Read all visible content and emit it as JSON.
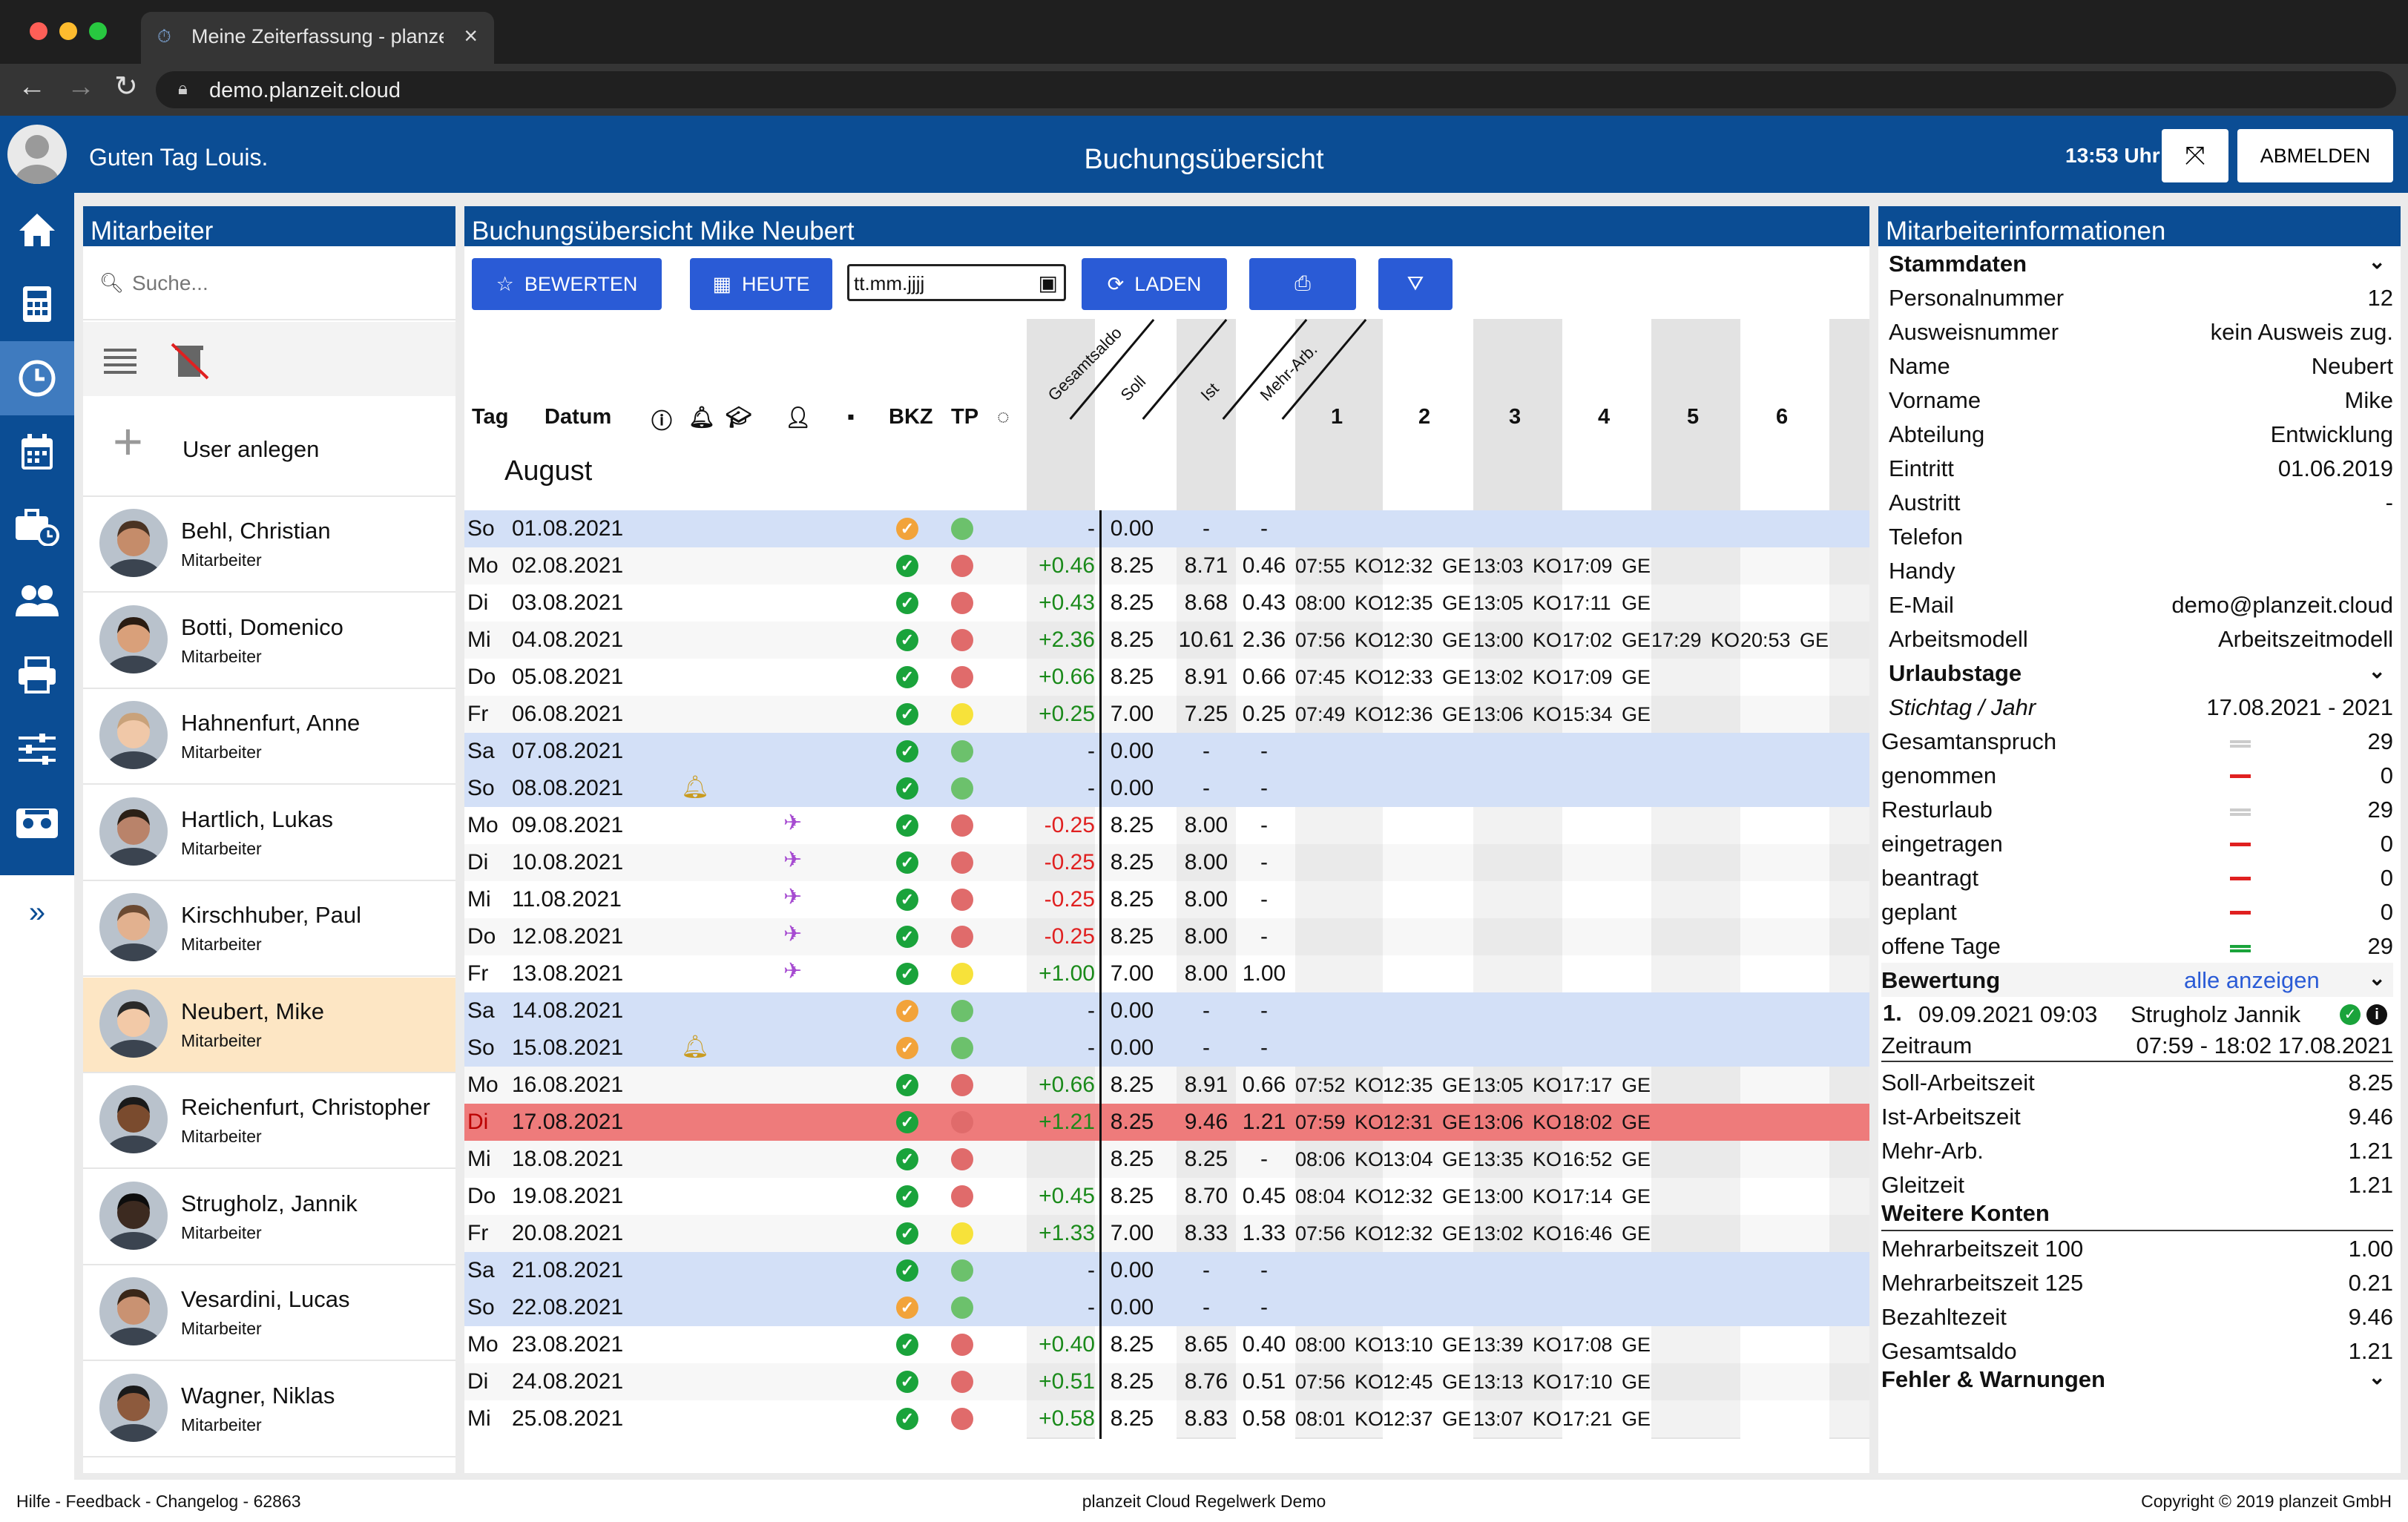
{
  "browser": {
    "tab_title": "Meine Zeiterfassung - planzeit",
    "url": "demo.planzeit.cloud"
  },
  "header": {
    "greeting": "Guten Tag Louis.",
    "title": "Buchungsübersicht",
    "clock": "13:53 Uhr",
    "logout": "ABMELDEN"
  },
  "nav": {
    "items": [
      "home-icon",
      "calculator-icon",
      "clock-icon",
      "calendar-icon",
      "briefcase-clock-icon",
      "users-icon",
      "printer-icon",
      "sliders-icon",
      "cassette-icon",
      "expand-icon"
    ]
  },
  "staff": {
    "title": "Mitarbeiter",
    "search_placeholder": "Suche...",
    "add_user": "User anlegen",
    "people": [
      {
        "name": "Behl, Christian",
        "role": "Mitarbeiter"
      },
      {
        "name": "Botti, Domenico",
        "role": "Mitarbeiter"
      },
      {
        "name": "Hahnenfurt, Anne",
        "role": "Mitarbeiter"
      },
      {
        "name": "Hartlich, Lukas",
        "role": "Mitarbeiter"
      },
      {
        "name": "Kirschhuber, Paul",
        "role": "Mitarbeiter"
      },
      {
        "name": "Neubert, Mike",
        "role": "Mitarbeiter"
      },
      {
        "name": "Reichenfurt, Christopher",
        "role": "Mitarbeiter"
      },
      {
        "name": "Strugholz, Jannik",
        "role": "Mitarbeiter"
      },
      {
        "name": "Vesardini, Lucas",
        "role": "Mitarbeiter"
      },
      {
        "name": "Wagner, Niklas",
        "role": "Mitarbeiter"
      }
    ],
    "selected": 5
  },
  "booking": {
    "title": "Buchungsübersicht  Mike Neubert",
    "buttons": {
      "rate": "BEWERTEN",
      "today": "HEUTE",
      "load": "LADEN"
    },
    "date_placeholder": "tt.mm.jjjj",
    "headers": {
      "day": "Tag",
      "date": "Datum",
      "bkz": "BKZ",
      "tp": "TP",
      "total": "Gesamtsaldo",
      "soll": "Soll",
      "ist": "Ist",
      "mehr": "Mehr-Arb.",
      "cols": [
        "1",
        "2",
        "3",
        "4",
        "5",
        "6"
      ]
    },
    "month": "August",
    "rows": [
      {
        "d": "So",
        "dt": "01.08.2021",
        "ic": "",
        "bk": "o",
        "tp": "g",
        "tot": "-",
        "soll": "0.00",
        "ist": "-",
        "mehr": "-",
        "t": [],
        "we": 1
      },
      {
        "d": "Mo",
        "dt": "02.08.2021",
        "ic": "",
        "bk": "g",
        "tp": "r",
        "tot": "+0.46",
        "soll": "8.25",
        "ist": "8.71",
        "mehr": "0.46",
        "t": [
          "07:55",
          "KO",
          "12:32",
          "GE",
          "13:03",
          "KO",
          "17:09",
          "GE"
        ]
      },
      {
        "d": "Di",
        "dt": "03.08.2021",
        "ic": "",
        "bk": "g",
        "tp": "r",
        "tot": "+0.43",
        "soll": "8.25",
        "ist": "8.68",
        "mehr": "0.43",
        "t": [
          "08:00",
          "KO",
          "12:35",
          "GE",
          "13:05",
          "KO",
          "17:11",
          "GE"
        ]
      },
      {
        "d": "Mi",
        "dt": "04.08.2021",
        "ic": "",
        "bk": "g",
        "tp": "r",
        "tot": "+2.36",
        "soll": "8.25",
        "ist": "10.61",
        "mehr": "2.36",
        "t": [
          "07:56",
          "KO",
          "12:30",
          "GE",
          "13:00",
          "KO",
          "17:02",
          "GE",
          "17:29",
          "KO",
          "20:53",
          "GE"
        ]
      },
      {
        "d": "Do",
        "dt": "05.08.2021",
        "ic": "",
        "bk": "g",
        "tp": "r",
        "tot": "+0.66",
        "soll": "8.25",
        "ist": "8.91",
        "mehr": "0.66",
        "t": [
          "07:45",
          "KO",
          "12:33",
          "GE",
          "13:02",
          "KO",
          "17:09",
          "GE"
        ]
      },
      {
        "d": "Fr",
        "dt": "06.08.2021",
        "ic": "",
        "bk": "g",
        "tp": "y",
        "tot": "+0.25",
        "soll": "7.00",
        "ist": "7.25",
        "mehr": "0.25",
        "t": [
          "07:49",
          "KO",
          "12:36",
          "GE",
          "13:06",
          "KO",
          "15:34",
          "GE"
        ]
      },
      {
        "d": "Sa",
        "dt": "07.08.2021",
        "ic": "",
        "bk": "g",
        "tp": "g",
        "tot": "-",
        "soll": "0.00",
        "ist": "-",
        "mehr": "-",
        "t": [],
        "we": 1
      },
      {
        "d": "So",
        "dt": "08.08.2021",
        "ic": "bell",
        "bk": "g",
        "tp": "g",
        "tot": "-",
        "soll": "0.00",
        "ist": "-",
        "mehr": "-",
        "t": [],
        "we": 1
      },
      {
        "d": "Mo",
        "dt": "09.08.2021",
        "ic": "plane",
        "bk": "g",
        "tp": "r",
        "tot": "-0.25",
        "soll": "8.25",
        "ist": "8.00",
        "mehr": "-",
        "t": []
      },
      {
        "d": "Di",
        "dt": "10.08.2021",
        "ic": "plane",
        "bk": "g",
        "tp": "r",
        "tot": "-0.25",
        "soll": "8.25",
        "ist": "8.00",
        "mehr": "-",
        "t": []
      },
      {
        "d": "Mi",
        "dt": "11.08.2021",
        "ic": "plane",
        "bk": "g",
        "tp": "r",
        "tot": "-0.25",
        "soll": "8.25",
        "ist": "8.00",
        "mehr": "-",
        "t": []
      },
      {
        "d": "Do",
        "dt": "12.08.2021",
        "ic": "plane",
        "bk": "g",
        "tp": "r",
        "tot": "-0.25",
        "soll": "8.25",
        "ist": "8.00",
        "mehr": "-",
        "t": []
      },
      {
        "d": "Fr",
        "dt": "13.08.2021",
        "ic": "plane",
        "bk": "g",
        "tp": "y",
        "tot": "+1.00",
        "soll": "7.00",
        "ist": "8.00",
        "mehr": "1.00",
        "t": []
      },
      {
        "d": "Sa",
        "dt": "14.08.2021",
        "ic": "",
        "bk": "o",
        "tp": "g",
        "tot": "-",
        "soll": "0.00",
        "ist": "-",
        "mehr": "-",
        "t": [],
        "we": 1
      },
      {
        "d": "So",
        "dt": "15.08.2021",
        "ic": "bell",
        "bk": "o",
        "tp": "g",
        "tot": "-",
        "soll": "0.00",
        "ist": "-",
        "mehr": "-",
        "t": [],
        "we": 1
      },
      {
        "d": "Mo",
        "dt": "16.08.2021",
        "ic": "",
        "bk": "g",
        "tp": "r",
        "tot": "+0.66",
        "soll": "8.25",
        "ist": "8.91",
        "mehr": "0.66",
        "t": [
          "07:52",
          "KO",
          "12:35",
          "GE",
          "13:05",
          "KO",
          "17:17",
          "GE"
        ]
      },
      {
        "d": "Di",
        "dt": "17.08.2021",
        "ic": "",
        "bk": "g",
        "tp": "r",
        "tot": "+1.21",
        "soll": "8.25",
        "ist": "9.46",
        "mehr": "1.21",
        "t": [
          "07:59",
          "KO",
          "12:31",
          "GE",
          "13:06",
          "KO",
          "18:02",
          "GE"
        ],
        "hl": 1
      },
      {
        "d": "Mi",
        "dt": "18.08.2021",
        "ic": "",
        "bk": "g",
        "tp": "r",
        "tot": "",
        "soll": "8.25",
        "ist": "8.25",
        "mehr": "-",
        "t": [
          "08:06",
          "KO",
          "13:04",
          "GE",
          "13:35",
          "KO",
          "16:52",
          "GE"
        ]
      },
      {
        "d": "Do",
        "dt": "19.08.2021",
        "ic": "",
        "bk": "g",
        "tp": "r",
        "tot": "+0.45",
        "soll": "8.25",
        "ist": "8.70",
        "mehr": "0.45",
        "t": [
          "08:04",
          "KO",
          "12:32",
          "GE",
          "13:00",
          "KO",
          "17:14",
          "GE"
        ]
      },
      {
        "d": "Fr",
        "dt": "20.08.2021",
        "ic": "",
        "bk": "g",
        "tp": "y",
        "tot": "+1.33",
        "soll": "7.00",
        "ist": "8.33",
        "mehr": "1.33",
        "t": [
          "07:56",
          "KO",
          "12:32",
          "GE",
          "13:02",
          "KO",
          "16:46",
          "GE"
        ]
      },
      {
        "d": "Sa",
        "dt": "21.08.2021",
        "ic": "",
        "bk": "g",
        "tp": "g",
        "tot": "-",
        "soll": "0.00",
        "ist": "-",
        "mehr": "-",
        "t": [],
        "we": 1
      },
      {
        "d": "So",
        "dt": "22.08.2021",
        "ic": "",
        "bk": "o",
        "tp": "g",
        "tot": "-",
        "soll": "0.00",
        "ist": "-",
        "mehr": "-",
        "t": [],
        "we": 1
      },
      {
        "d": "Mo",
        "dt": "23.08.2021",
        "ic": "",
        "bk": "g",
        "tp": "r",
        "tot": "+0.40",
        "soll": "8.25",
        "ist": "8.65",
        "mehr": "0.40",
        "t": [
          "08:00",
          "KO",
          "13:10",
          "GE",
          "13:39",
          "KO",
          "17:08",
          "GE"
        ]
      },
      {
        "d": "Di",
        "dt": "24.08.2021",
        "ic": "",
        "bk": "g",
        "tp": "r",
        "tot": "+0.51",
        "soll": "8.25",
        "ist": "8.76",
        "mehr": "0.51",
        "t": [
          "07:56",
          "KO",
          "12:45",
          "GE",
          "13:13",
          "KO",
          "17:10",
          "GE"
        ]
      },
      {
        "d": "Mi",
        "dt": "25.08.2021",
        "ic": "",
        "bk": "g",
        "tp": "r",
        "tot": "+0.58",
        "soll": "8.25",
        "ist": "8.83",
        "mehr": "0.58",
        "t": [
          "08:01",
          "KO",
          "12:37",
          "GE",
          "13:07",
          "KO",
          "17:21",
          "GE"
        ]
      }
    ]
  },
  "info": {
    "title": "Mitarbeiterinformationen",
    "stamm_title": "Stammdaten",
    "stamm": [
      [
        "Personalnummer",
        "12"
      ],
      [
        "Ausweisnummer",
        "kein Ausweis zug."
      ],
      [
        "Name",
        "Neubert"
      ],
      [
        "Vorname",
        "Mike"
      ],
      [
        "Abteilung",
        "Entwicklung"
      ],
      [
        "Eintritt",
        "01.06.2019"
      ],
      [
        "Austritt",
        "-"
      ],
      [
        "Telefon",
        ""
      ],
      [
        "Handy",
        ""
      ],
      [
        "E-Mail",
        "demo@planzeit.cloud"
      ],
      [
        "Arbeitsmodell",
        "Arbeitszeitmodell"
      ]
    ],
    "urlaub_title": "Urlaubstage",
    "stichtag": [
      "Stichtag / Jahr",
      "17.08.2021 - 2021"
    ],
    "urlaub": [
      [
        "Gesamtanspruch",
        "=",
        "29"
      ],
      [
        "genommen",
        "-",
        "0"
      ],
      [
        "Resturlaub",
        "=",
        "29"
      ],
      [
        "eingetragen",
        "-",
        "0"
      ],
      [
        "beantragt",
        "-",
        "0"
      ],
      [
        "geplant",
        "-",
        "0"
      ],
      [
        "offene Tage",
        "=",
        "29"
      ]
    ],
    "bewertung_title": "Bewertung",
    "show_all": "alle anzeigen",
    "bewertung": {
      "num": "1.",
      "time": "09.09.2021 09:03",
      "who": "Strugholz Jannik",
      "zeitraum_label": "Zeitraum",
      "zeitraum": "07:59 - 18:02 17.08.2021"
    },
    "arbeit": [
      [
        "Soll-Arbeitszeit",
        "8.25"
      ],
      [
        "Ist-Arbeitszeit",
        "9.46"
      ],
      [
        "Mehr-Arb.",
        "1.21"
      ],
      [
        "Gleitzeit",
        "1.21"
      ]
    ],
    "konten_title": "Weitere Konten",
    "konten": [
      [
        "Mehrarbeitszeit 100",
        "1.00"
      ],
      [
        "Mehrarbeitszeit 125",
        "0.21"
      ],
      [
        "Bezahltezeit",
        "9.46"
      ],
      [
        "Gesamtsaldo",
        "1.21"
      ]
    ],
    "fehler_title": "Fehler & Warnungen"
  },
  "footer": {
    "left": "Hilfe - Feedback - Changelog - 62863",
    "center": "planzeit Cloud Regelwerk Demo",
    "right": "Copyright © 2019 planzeit GmbH"
  },
  "colors": {
    "brand": "#0b4d94",
    "button": "#2a5bd6",
    "highlight": "#ee7b7b",
    "weekend": "#d3e0f7",
    "positive": "#1a8a1a",
    "negative": "#e02020"
  }
}
